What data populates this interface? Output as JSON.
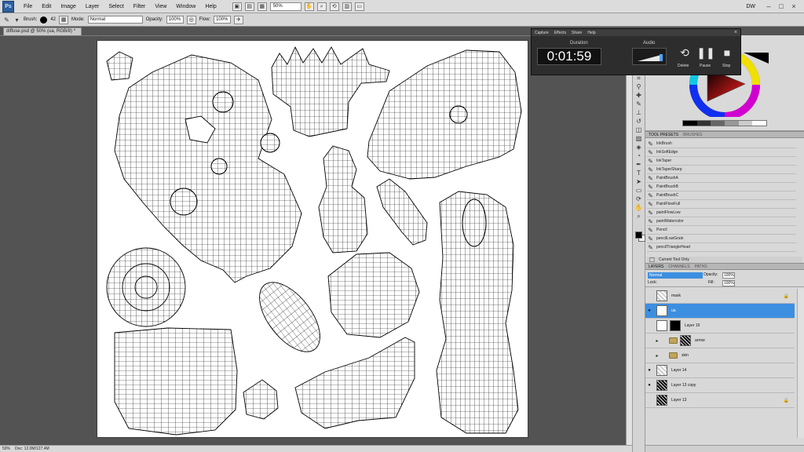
{
  "menubar": {
    "logo": "Ps",
    "items": [
      "File",
      "Edit",
      "Image",
      "Layer",
      "Select",
      "Filter",
      "View",
      "Window",
      "Help"
    ],
    "zoom": "50%",
    "workspace": "DW",
    "window_controls": [
      "–",
      "□",
      "×"
    ]
  },
  "options": {
    "brush_label": "Brush:",
    "brush_size": "42",
    "mode_label": "Mode:",
    "mode_value": "Normal",
    "opacity_label": "Opacity:",
    "opacity_value": "100%",
    "flow_label": "Flow:",
    "flow_value": "100%"
  },
  "document": {
    "tab_title": "diffuse.psd @ 50% (ua, RGB/8) *",
    "status_zoom": "50%",
    "status_doc": "Doc: 12.0M/127.4M"
  },
  "capture": {
    "tabs": [
      "Capture",
      "Effects",
      "Share",
      "Help"
    ],
    "duration_label": "Duration",
    "duration_value": "0:01:59",
    "audio_label": "Audio",
    "buttons": [
      "Delete",
      "Pause",
      "Stop"
    ]
  },
  "presets": {
    "tabs": [
      "TOOL PRESETS",
      "BRUSHES"
    ],
    "items": [
      "InkBrush",
      "InkSoftEdge",
      "InkTaper",
      "InkTaperSharp",
      "PaintBrushA",
      "PaintBrushB",
      "PaintBrushC",
      "PaintFlowFull",
      "paintFlowLow",
      "paintWatercolor",
      "Pencil",
      "pencilLowGrain",
      "pencilTriangleHead"
    ],
    "footer": "Current Tool Only"
  },
  "layers": {
    "tabs": [
      "LAYERS",
      "CHANNELS",
      "PATHS"
    ],
    "blend_mode": "Normal",
    "opacity_label": "Opacity:",
    "opacity_value": "100%",
    "lock_label": "Lock:",
    "fill_label": "Fill:",
    "fill_value": "100%",
    "rows": [
      {
        "name": "mask"
      },
      {
        "name": "ua"
      },
      {
        "name": "Layer 16"
      },
      {
        "name": "armor"
      },
      {
        "name": "skin"
      },
      {
        "name": "Layer 14"
      },
      {
        "name": "Layer 13 copy"
      },
      {
        "name": "Layer 13"
      }
    ]
  },
  "colors": {
    "accent_blue": "#3c8fe0",
    "panel_gray": "#d6d6d6",
    "canvas_bg": "#535353"
  }
}
